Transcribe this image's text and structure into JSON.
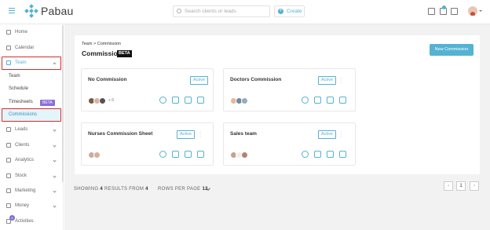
{
  "app": {
    "name": "Pabau"
  },
  "topbar": {
    "search_placeholder": "Search clients or leads",
    "create_label": "Create"
  },
  "sidebar": {
    "items": [
      {
        "label": "Home",
        "icon": "home-icon"
      },
      {
        "label": "Calendar",
        "icon": "calendar-icon"
      },
      {
        "label": "Team",
        "icon": "team-icon"
      },
      {
        "label": "Leads",
        "icon": "leads-icon"
      },
      {
        "label": "Clients",
        "icon": "clients-icon"
      },
      {
        "label": "Analytics",
        "icon": "analytics-icon"
      },
      {
        "label": "Stock",
        "icon": "stock-icon"
      },
      {
        "label": "Marketing",
        "icon": "marketing-icon"
      },
      {
        "label": "Money",
        "icon": "money-icon"
      },
      {
        "label": "Activities",
        "icon": "activities-icon",
        "badge": "8"
      }
    ],
    "team_sub": [
      "Team",
      "Schedule",
      "Timesheets",
      "Commissions"
    ],
    "beta_label": "BETA"
  },
  "page": {
    "breadcrumb": "Team > Commission",
    "title": "Commission",
    "beta_label": "BETA",
    "new_button": "New Commission"
  },
  "cards": [
    {
      "name": "No Commission",
      "status": "Active",
      "more": "+ 6"
    },
    {
      "name": "Doctors Commission",
      "status": "Active",
      "more": ""
    },
    {
      "name": "Nurses Commission Sheet",
      "status": "Active",
      "more": ""
    },
    {
      "name": "Sales team",
      "status": "Active",
      "more": ""
    }
  ],
  "footer": {
    "showing_prefix": "SHOWING",
    "showing_count": "4",
    "results_from": "RESULTS FROM",
    "total": "4",
    "rows_label": "ROWS PER PAGE",
    "rows_value": "12",
    "page": "1",
    "prev": "‹",
    "next": "›"
  },
  "colors": {
    "accent": "#54b2d3",
    "highlight": "#d62b2b",
    "beta": "#8a6dd9"
  }
}
